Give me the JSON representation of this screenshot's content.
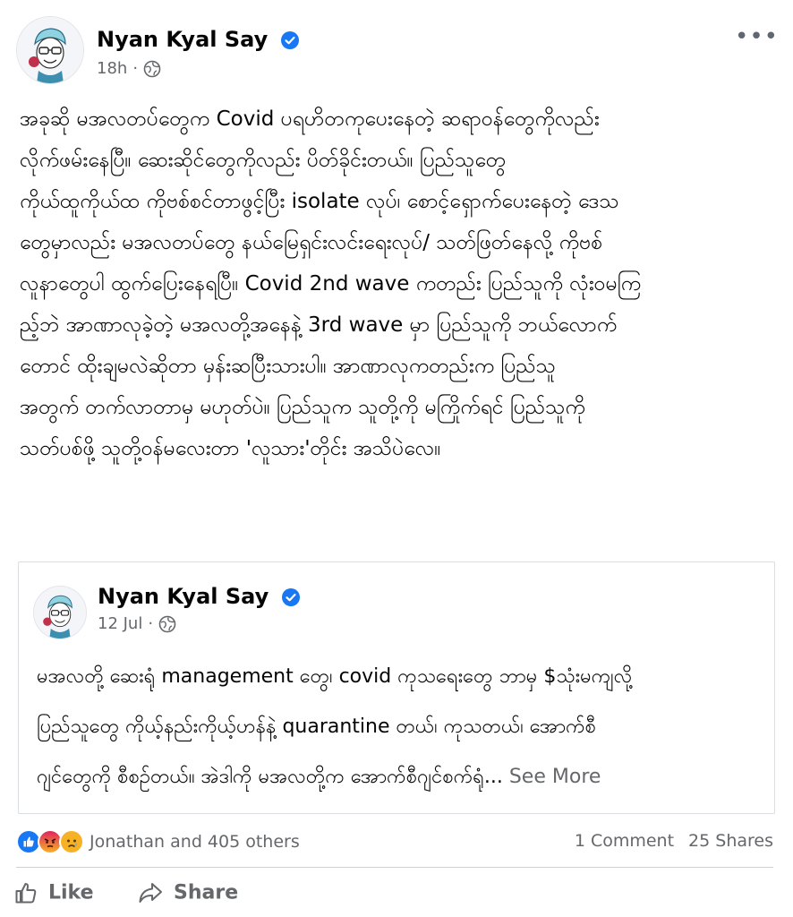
{
  "post": {
    "author": "Nyan Kyal Say",
    "time": "18h",
    "text": "အခုဆို မအလတပ်တွေက Covid ပရဟိတကုပေးနေတဲ့ ဆရာဝန်တွေကိုလည်း\nလိုက်ဖမ်းနေပြီ။ ဆေးဆိုင်တွေကိုလည်း ပိတ်ခိုင်းတယ်။ ပြည်သူတွေ\nကိုယ်ထူကိုယ်ထ ကိုဗစ်စင်တာဖွင့်ပြီး isolate လုပ်၊ စောင့်ရှောက်ပေးနေတဲ့ ဒေသ\nတွေမှာလည်း မအလတပ်တွေ နယ်မြေရှင်းလင်းရေးလုပ်/ သတ်ဖြတ်နေလို့ ကိုဗစ်\nလူနာတွေပါ ထွက်ပြေးနေရပြီ။ Covid 2nd wave ကတည်း ပြည်သူကို လုံးဝမကြ\nည့်ဘဲ အာဏာလုခဲ့တဲ့ မအလတို့အနေနဲ့ 3rd wave မှာ ပြည်သူကို ဘယ်လောက်\nတောင် ထိုးချမလဲဆိုတာ မှန်းဆပြီးသားပါ။ အာဏာလုကတည်းက ပြည်သူ\nအတွက် တက်လာတာမှ မဟုတ်ပဲ။ ပြည်သူက သူတို့ကို မကြိုက်ရင် ပြည်သူကို\nသတ်ပစ်ဖို့ သူတို့ဝန်မလေးတာ 'လူသား'တိုင်း အသိပဲလေ။"
  },
  "shared": {
    "author": "Nyan Kyal Say",
    "time": "12 Jul",
    "text": "မအလတို့ ဆေးရုံ management တွေ၊ covid ကုသရေးတွေ ဘာမှ $သုံးမကျလို့\nပြည်သူတွေ ကိုယ့်နည်းကိုယ့်ဟန်နဲ့ quarantine တယ်၊ ကုသတယ်၊ အောက်စီ\nဂျင်တွေကို စီစဥ်တယ်။ အဲဒါကို မအလတို့က အောက်စီဂျင်စက်ရုံ...",
    "see_more": "See More"
  },
  "engagement": {
    "reactions_text": "Jonathan and 405 others",
    "comments": "1 Comment",
    "shares": "25 Shares",
    "reaction_icons": [
      "like-reaction-icon",
      "angry-reaction-icon",
      "sad-reaction-icon"
    ]
  },
  "actions": {
    "like": "Like",
    "share": "Share"
  },
  "colors": {
    "text": "#050505",
    "secondary": "#65676b",
    "verified": "#1877f2",
    "like_blue": "#1877f2",
    "angry": "#e9710f",
    "sad": "#f7b125"
  }
}
